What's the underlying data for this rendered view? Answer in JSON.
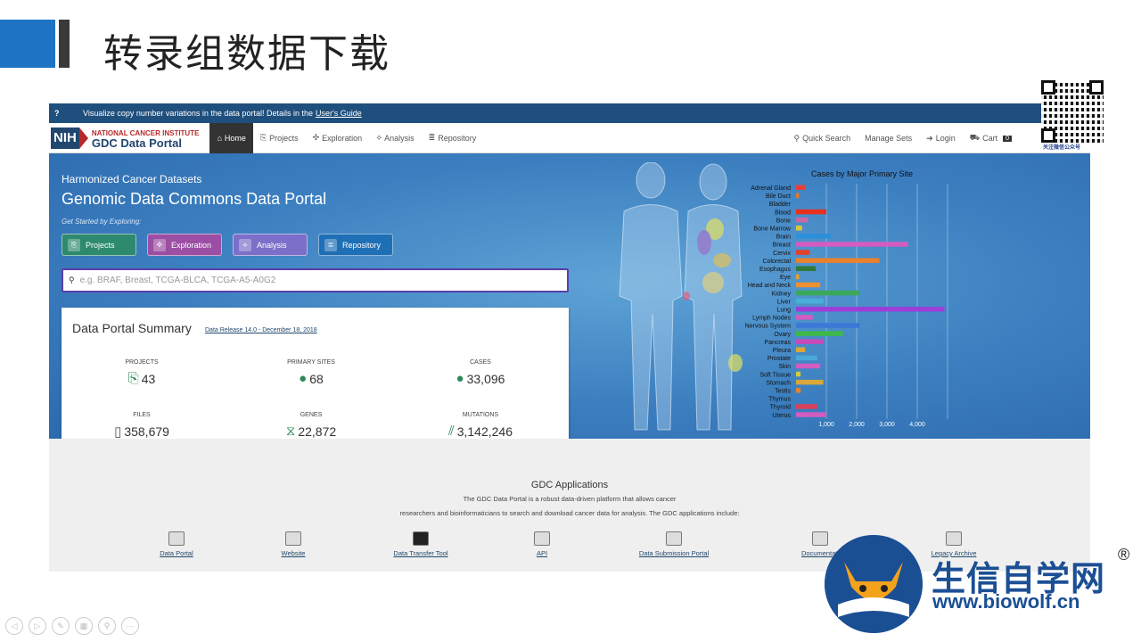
{
  "slide": {
    "title": "转录组数据下载"
  },
  "announcement": {
    "icon": "?",
    "text": "Visualize copy number variations in the data portal! Details in the",
    "link": "User's Guide"
  },
  "logo": {
    "nih": "NIH",
    "nci": "NATIONAL CANCER INSTITUTE",
    "gdc": "GDC Data Portal"
  },
  "nav": {
    "items": [
      {
        "label": "Home",
        "icon": "home-icon",
        "active": true
      },
      {
        "label": "Projects",
        "icon": "projects-icon"
      },
      {
        "label": "Exploration",
        "icon": "exploration-icon"
      },
      {
        "label": "Analysis",
        "icon": "analysis-icon"
      },
      {
        "label": "Repository",
        "icon": "repository-icon"
      }
    ],
    "right": [
      {
        "label": "Quick Search",
        "icon": "search-icon"
      },
      {
        "label": "Manage Sets"
      },
      {
        "label": "Login",
        "icon": "login-icon"
      },
      {
        "label": "Cart",
        "icon": "cart-icon",
        "badge": "0"
      }
    ]
  },
  "hero": {
    "subtitle": "Harmonized Cancer Datasets",
    "title": "Genomic Data Commons Data Portal",
    "started": "Get Started by Exploring:",
    "buttons": [
      {
        "label": "Projects",
        "color": "#2e8a6f"
      },
      {
        "label": "Exploration",
        "color": "#9b4ea3"
      },
      {
        "label": "Analysis",
        "color": "#7b6fc9"
      },
      {
        "label": "Repository",
        "color": "#1e6fb5"
      }
    ],
    "search_placeholder": "e.g. BRAF, Breast, TCGA-BLCA, TCGA-A5-A0G2"
  },
  "summary": {
    "title": "Data Portal Summary",
    "release": "Data Release 14.0 - December 18, 2018",
    "stats": [
      {
        "label": "PROJECTS",
        "value": "43",
        "icon": "projects-icon"
      },
      {
        "label": "PRIMARY SITES",
        "value": "68",
        "icon": "person-icon"
      },
      {
        "label": "CASES",
        "value": "33,096",
        "icon": "person-icon"
      },
      {
        "label": "FILES",
        "value": "358,679",
        "icon": "file-icon"
      },
      {
        "label": "GENES",
        "value": "22,872",
        "icon": "dna-icon"
      },
      {
        "label": "MUTATIONS",
        "value": "3,142,246",
        "icon": "mutation-icon"
      }
    ]
  },
  "chart_data": {
    "type": "bar",
    "title": "Cases by Major Primary Site",
    "orientation": "horizontal",
    "categories": [
      "Adrenal Gland",
      "Bile Duct",
      "Bladder",
      "Blood",
      "Bone",
      "Bone Marrow",
      "Brain",
      "Breast",
      "Cervix",
      "Colorectal",
      "Esophagus",
      "Eye",
      "Head and Neck",
      "Kidney",
      "Liver",
      "Lung",
      "Lymph Nodes",
      "Nervous System",
      "Ovary",
      "Pancreas",
      "Pleura",
      "Prostate",
      "Skin",
      "Soft Tissue",
      "Stomach",
      "Testis",
      "Thymus",
      "Thyroid",
      "Uterus"
    ],
    "values": [
      300,
      100,
      0,
      1000,
      400,
      200,
      1150,
      3700,
      450,
      2750,
      650,
      100,
      800,
      2100,
      900,
      4900,
      550,
      2100,
      1550,
      900,
      300,
      700,
      800,
      150,
      900,
      150,
      0,
      700,
      1000
    ],
    "colors": [
      "#e8403a",
      "#e07a2b",
      "#999999",
      "#e8301c",
      "#c66aa5",
      "#d9c83a",
      "#2b8fd9",
      "#d35cc0",
      "#e3402e",
      "#e8822f",
      "#2f7a3a",
      "#e8a02e",
      "#f09030",
      "#3aa85a",
      "#48b0d8",
      "#9b3fd8",
      "#d35cc0",
      "#3b78d8",
      "#3fb84a",
      "#c64ab8",
      "#d9a83a",
      "#4aa8d8",
      "#d35cc0",
      "#d9c83a",
      "#d9a83a",
      "#e8822f",
      "#999999",
      "#d9405a",
      "#d35cc0"
    ],
    "xlim": [
      0,
      5000
    ],
    "xticks": [
      "1,000",
      "2,000",
      "3,000",
      "4,000"
    ],
    "grid": true
  },
  "apps": {
    "title": "GDC Applications",
    "desc1": "The GDC Data Portal is a robust data-driven platform that allows cancer",
    "desc2": "researchers and bioinformaticians to search and download cancer data for analysis. The GDC applications include:",
    "items": [
      {
        "label": "Data Portal",
        "icon": "data-portal-icon"
      },
      {
        "label": "Website",
        "icon": "website-icon"
      },
      {
        "label": "Data Transfer Tool",
        "icon": "terminal-icon"
      },
      {
        "label": "API",
        "icon": "api-icon"
      },
      {
        "label": "Data Submission Portal",
        "icon": "submission-icon"
      },
      {
        "label": "Documentati",
        "icon": "document-icon"
      },
      {
        "label": "Legacy Archive",
        "icon": "archive-icon"
      }
    ]
  },
  "qr": {
    "caption": "关注微信公众号"
  },
  "brand": {
    "name": "生信自学网",
    "reg": "®",
    "url": "www.biowolf.cn"
  },
  "player": {
    "controls": [
      "prev-icon",
      "next-icon",
      "pen-icon",
      "slides-icon",
      "zoom-icon",
      "more-icon"
    ]
  }
}
